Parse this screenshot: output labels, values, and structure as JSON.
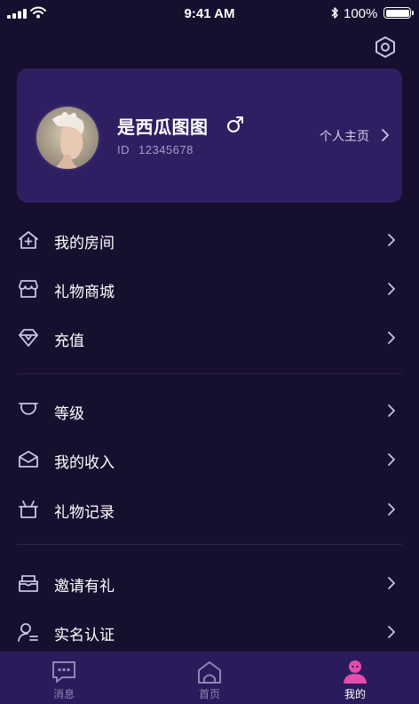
{
  "status_bar": {
    "time": "9:41 AM",
    "battery": "100%"
  },
  "profile": {
    "name": "是西瓜图图",
    "id_label": "ID",
    "id_value": "12345678",
    "homepage_label": "个人主页"
  },
  "menu": {
    "groups": [
      [
        {
          "label": "我的房间",
          "icon": "house-plus-icon"
        },
        {
          "label": "礼物商城",
          "icon": "store-icon"
        },
        {
          "label": "充值",
          "icon": "diamond-icon"
        }
      ],
      [
        {
          "label": "等级",
          "icon": "level-badge-icon"
        },
        {
          "label": "我的收入",
          "icon": "income-envelope-icon"
        },
        {
          "label": "礼物记录",
          "icon": "gift-box-icon"
        }
      ],
      [
        {
          "label": "邀请有礼",
          "icon": "invite-mail-icon"
        },
        {
          "label": "实名认证",
          "icon": "user-verify-icon"
        }
      ]
    ]
  },
  "tabbar": {
    "tabs": [
      {
        "label": "消息",
        "icon": "message-bubble-icon",
        "active": false
      },
      {
        "label": "首页",
        "icon": "home-icon",
        "active": false
      },
      {
        "label": "我的",
        "icon": "profile-icon",
        "active": true
      }
    ]
  },
  "colors": {
    "background": "#170f2e",
    "card": "#2f1f62",
    "tabbar": "#2c1b5c",
    "accent_pink": "#e64cae",
    "icon_stroke": "#c9c2e6"
  }
}
